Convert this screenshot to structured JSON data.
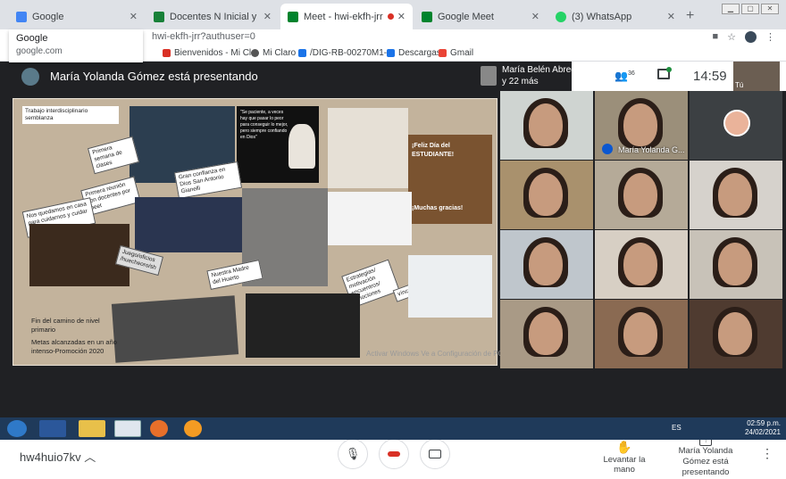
{
  "browser": {
    "tabs": [
      {
        "title": "Google",
        "color": "#4285f4",
        "active": false
      },
      {
        "title": "Docentes N Inicial y Primario TC",
        "color": "#188038",
        "active": false
      },
      {
        "title": "Meet - hwi-ekfh-jrr",
        "color": "#00832d",
        "active": true
      },
      {
        "title": "Google Meet",
        "color": "#00832d",
        "active": false
      },
      {
        "title": "(3) WhatsApp",
        "color": "#25d366",
        "active": false
      }
    ],
    "url": "hwi-ekfh-jrr?authuser=0",
    "suggestion": {
      "title": "Google",
      "domain": "google.com"
    },
    "bookmarks": [
      "Bienvenidos - Mi Cl...",
      "Mi Claro",
      "/DIG-RB-00270M1-...",
      "Descargas",
      "Gmail"
    ]
  },
  "meet": {
    "presenting_title": "María Yolanda Gómez está presentando",
    "top_participant": {
      "name": "María Belén Abregu ...",
      "more": "y 22 más"
    },
    "people_count": "36",
    "clock": "14:59",
    "self_label": "Tú",
    "meeting_code": "hw4huio7kv",
    "raise_hand": "Levantar la mano",
    "presenter_status": "María Yolanda Gómez está presentando",
    "pinned_tile_name": "María Yolanda G...",
    "colors": {
      "bg": "#202124",
      "hangup": "#d93025",
      "accent": "#1a73e8"
    }
  },
  "slide": {
    "labels": [
      "Trabajo interdisciplinario semblanza",
      "Primera semana de clases",
      "Primera reunión con docentes por meet",
      "Gran confianza en Dios San Antonio Gianelli",
      "Nos quedamos en casa para cuidarnos y cuidar a otros",
      "Nuestra Madre del Huerto",
      "Estrategias/ motivación encuentros/ emociones",
      "vínculos",
      "Juego/oficios /huecheoro/sh"
    ],
    "quote": "\"Se paciente, a veces hay que pasar lo peor para conseguir lo mejor, pero siempre confiando en Dios\"",
    "banner_top": "¡Feliz Día del ESTUDIANTE!",
    "banner_bottom": "¡Muchas gracias!",
    "footer_lines": [
      "Fin del camino de nivel primario",
      "Metas alcanzadas en un año intenso-Promoción 2020"
    ],
    "watermark": "Activar Windows Ve a Configuración de PC para activar Windows."
  },
  "taskbar": {
    "language": "ES",
    "time": "02:59 p.m.",
    "date": "24/02/2021"
  }
}
